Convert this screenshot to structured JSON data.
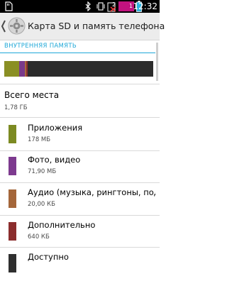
{
  "status_bar": {
    "time": "12:32",
    "badge_1": "2",
    "badge_2": "1",
    "icons": [
      "sd-card-icon",
      "bluetooth-icon",
      "vibrate-icon",
      "no-sim-icon",
      "notification-icon",
      "battery-icon"
    ]
  },
  "header": {
    "title": "Карта SD и память телефона",
    "icons": [
      "back-chevron-icon",
      "settings-app-icon"
    ]
  },
  "internal_storage": {
    "section_title": "ВНУТРЕННЯЯ ПАМЯТЬ",
    "total_label": "Всего места",
    "total_value": "1,78 ГБ",
    "usage_bar": {
      "colors": [
        "#8a8f24",
        "#7a3a8a",
        "#a86a3b",
        "#8a2f2f",
        "#2b2b2b"
      ],
      "fractions": {
        "apps": 0.1,
        "photos_video": 0.04,
        "audio": 0.01,
        "misc": 0.01,
        "available": 0.84
      }
    },
    "categories": [
      {
        "label": "Приложения",
        "value": "178 МБ",
        "color": "#7c8a22"
      },
      {
        "label": "Фото, видео",
        "value": "71,90 МБ",
        "color": "#7d3a8f"
      },
      {
        "label": "Аудио (музыка, рингтоны, подкасты)",
        "value": "20,00 КБ",
        "color": "#a4663a"
      },
      {
        "label": "Дополнительно",
        "value": "640 КБ",
        "color": "#8b2d2d"
      },
      {
        "label": "Доступно",
        "value": "",
        "color": "#2f2f2f"
      }
    ]
  }
}
